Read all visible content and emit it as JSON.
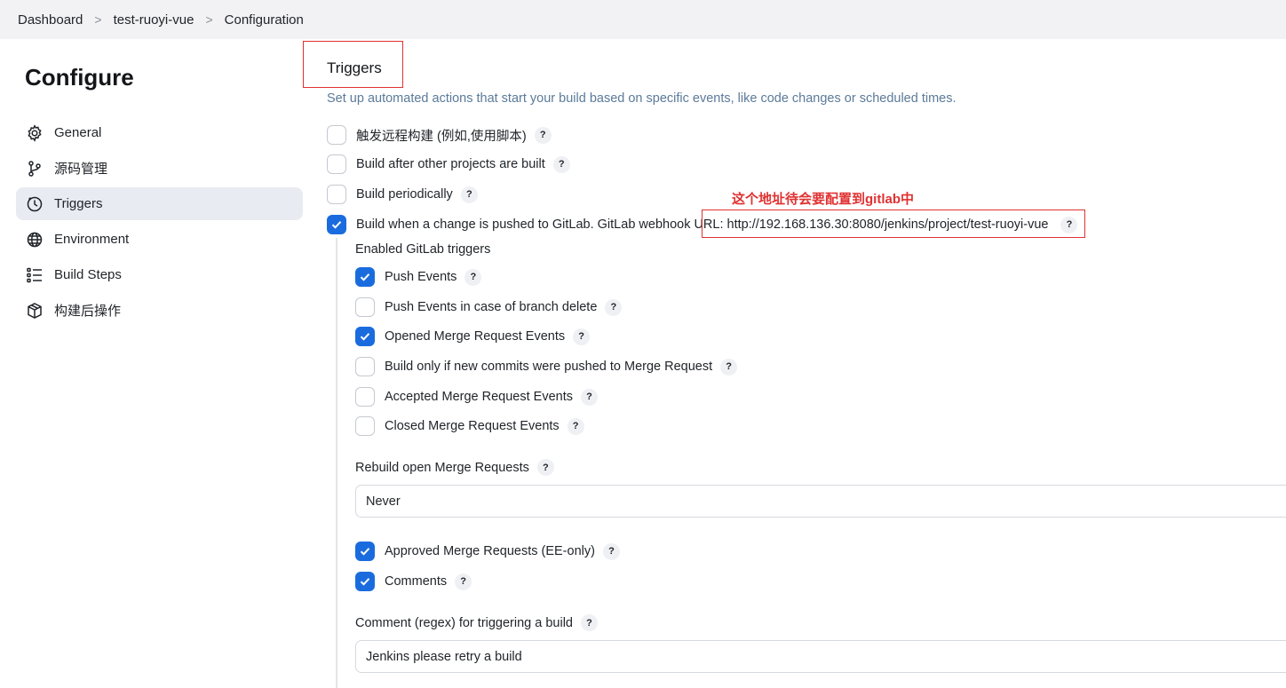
{
  "breadcrumb": {
    "items": [
      "Dashboard",
      "test-ruoyi-vue",
      "Configuration"
    ],
    "separator": ">"
  },
  "sidebar": {
    "title": "Configure",
    "items": [
      {
        "label": "General",
        "icon": "gear-icon",
        "active": false
      },
      {
        "label": "源码管理",
        "icon": "branch-icon",
        "active": false
      },
      {
        "label": "Triggers",
        "icon": "clock-icon",
        "active": true
      },
      {
        "label": "Environment",
        "icon": "globe-icon",
        "active": false
      },
      {
        "label": "Build Steps",
        "icon": "list-icon",
        "active": false
      },
      {
        "label": "构建后操作",
        "icon": "package-icon",
        "active": false
      }
    ]
  },
  "section": {
    "title": "Triggers",
    "description": "Set up automated actions that start your build based on specific events, like code changes or scheduled times."
  },
  "triggers": [
    {
      "label": "触发远程构建 (例如,使用脚本)",
      "checked": false
    },
    {
      "label": "Build after other projects are built",
      "checked": false
    },
    {
      "label": "Build periodically",
      "checked": false
    },
    {
      "label": "Build when a change is pushed to GitLab. GitLab webhook",
      "url": "URL: http://192.168.136.30:8080/jenkins/project/test-ruoyi-vue",
      "checked": true
    }
  ],
  "annotation": "这个地址待会要配置到gitlab中",
  "gitlab": {
    "enabled_label": "Enabled GitLab triggers",
    "events": [
      {
        "label": "Push Events",
        "checked": true
      },
      {
        "label": "Push Events in case of branch delete",
        "checked": false
      },
      {
        "label": "Opened Merge Request Events",
        "checked": true
      },
      {
        "label": "Build only if new commits were pushed to Merge Request",
        "checked": false
      },
      {
        "label": "Accepted Merge Request Events",
        "checked": false
      },
      {
        "label": "Closed Merge Request Events",
        "checked": false
      }
    ],
    "rebuild_label": "Rebuild open Merge Requests",
    "rebuild_value": "Never",
    "more_events": [
      {
        "label": "Approved Merge Requests (EE-only)",
        "checked": true
      },
      {
        "label": "Comments",
        "checked": true
      }
    ],
    "comment_label": "Comment (regex) for triggering a build",
    "comment_value": "Jenkins please retry a build"
  },
  "help_glyph": "?",
  "colors": {
    "accent": "#1a6cde",
    "annotation": "#e03131",
    "active_bg": "#e8ebf1"
  }
}
